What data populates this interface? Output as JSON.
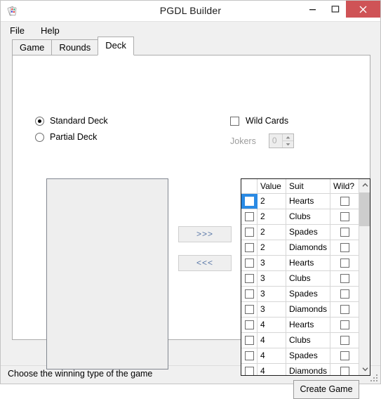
{
  "window": {
    "title": "PGDL Builder",
    "icon": "playing-cards-icon",
    "minimize": "minimize-icon",
    "maximize": "maximize-icon",
    "close": "close-icon",
    "close_color": "#cf5356"
  },
  "menubar": {
    "items": [
      {
        "label": "File"
      },
      {
        "label": "Help"
      }
    ]
  },
  "tabs": [
    {
      "label": "Game",
      "active": false
    },
    {
      "label": "Rounds",
      "active": false
    },
    {
      "label": "Deck",
      "active": true
    }
  ],
  "deck_options": {
    "standard": {
      "label": "Standard Deck",
      "checked": true
    },
    "partial": {
      "label": "Partial Deck",
      "checked": false
    },
    "wild_cards": {
      "label": "Wild Cards",
      "checked": false
    },
    "jokers": {
      "label": "Jokers",
      "value": "0",
      "disabled": true,
      "up_icon": "spinner-up-icon",
      "down_icon": "spinner-down-icon"
    }
  },
  "transfer": {
    "add_label": ">>>",
    "remove_label": "<<<",
    "accent": "#5a78a8"
  },
  "selected_list": {
    "items": []
  },
  "grid": {
    "columns": [
      "",
      "Value",
      "Suit",
      "Wild?"
    ],
    "selection_color": "#2a8ae4",
    "scroll_up_icon": "chevron-up-icon",
    "scroll_down_icon": "chevron-down-icon",
    "rows": [
      {
        "selected": true,
        "value": "2",
        "suit": "Hearts",
        "wild": false
      },
      {
        "selected": false,
        "value": "2",
        "suit": "Clubs",
        "wild": false
      },
      {
        "selected": false,
        "value": "2",
        "suit": "Spades",
        "wild": false
      },
      {
        "selected": false,
        "value": "2",
        "suit": "Diamonds",
        "wild": false
      },
      {
        "selected": false,
        "value": "3",
        "suit": "Hearts",
        "wild": false
      },
      {
        "selected": false,
        "value": "3",
        "suit": "Clubs",
        "wild": false
      },
      {
        "selected": false,
        "value": "3",
        "suit": "Spades",
        "wild": false
      },
      {
        "selected": false,
        "value": "3",
        "suit": "Diamonds",
        "wild": false
      },
      {
        "selected": false,
        "value": "4",
        "suit": "Hearts",
        "wild": false
      },
      {
        "selected": false,
        "value": "4",
        "suit": "Clubs",
        "wild": false
      },
      {
        "selected": false,
        "value": "4",
        "suit": "Spades",
        "wild": false
      },
      {
        "selected": false,
        "value": "4",
        "suit": "Diamonds",
        "wild": false
      }
    ]
  },
  "footer": {
    "create_game_label": "Create Game"
  },
  "statusbar": {
    "text": "Choose the winning type of the game",
    "grip": "resize-grip-icon"
  }
}
